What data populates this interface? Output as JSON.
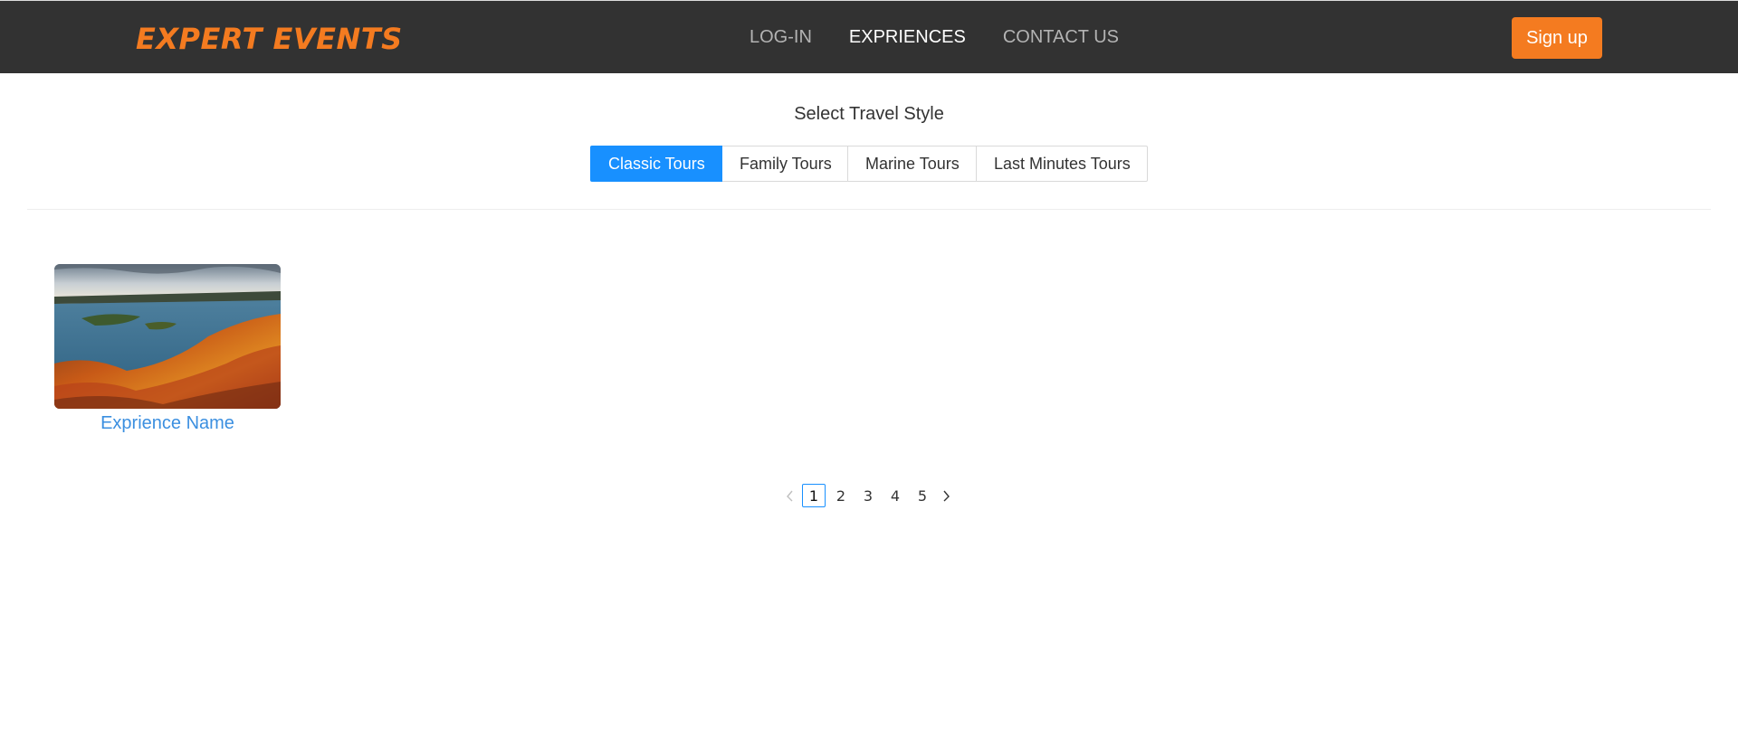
{
  "header": {
    "logo": "EXPERT EVENTS",
    "nav": [
      {
        "label": "LOG-IN",
        "active": false
      },
      {
        "label": "EXPRIENCES",
        "active": true
      },
      {
        "label": "CONTACT US",
        "active": false
      }
    ],
    "signup_label": "Sign up"
  },
  "travel_style": {
    "title": "Select Travel Style",
    "tabs": [
      {
        "label": "Classic Tours",
        "selected": true
      },
      {
        "label": "Family Tours",
        "selected": false
      },
      {
        "label": "Marine Tours",
        "selected": false
      },
      {
        "label": "Last Minutes Tours",
        "selected": false
      }
    ]
  },
  "experiences": [
    {
      "name": "Exprience Name",
      "image": "autumn-lake-aerial-photo"
    }
  ],
  "pagination": {
    "current": 1,
    "pages": [
      "1",
      "2",
      "3",
      "4",
      "5"
    ],
    "prev_icon": "chevron-left-icon",
    "next_icon": "chevron-right-icon"
  },
  "colors": {
    "header_bg": "#323232",
    "brand_orange": "#f47b20",
    "accent_blue": "#1890ff",
    "link_blue": "#3b8fe0"
  }
}
